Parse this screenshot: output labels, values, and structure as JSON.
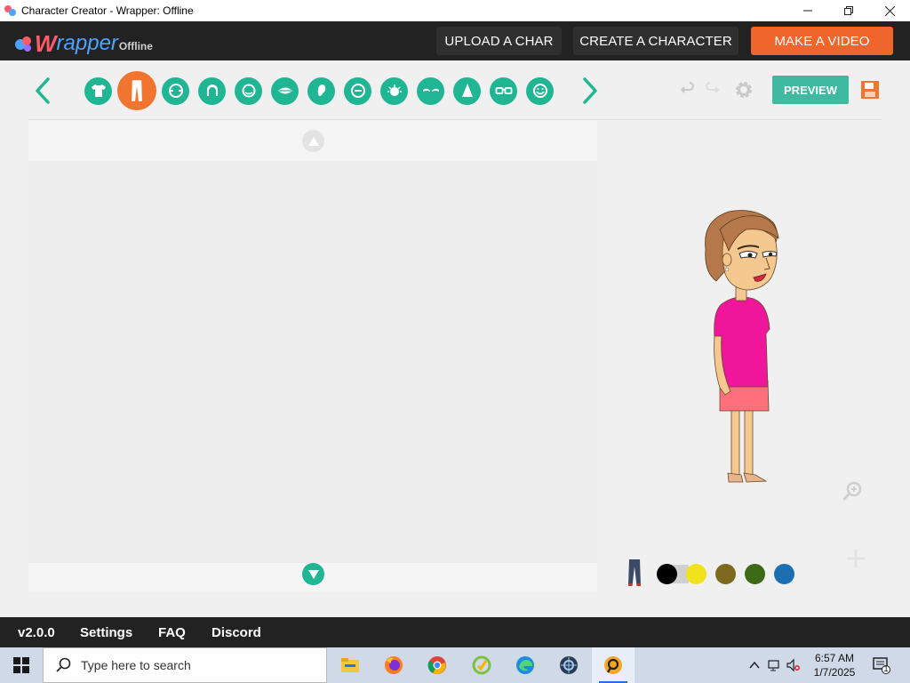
{
  "window": {
    "title": "Character Creator - Wrapper: Offline",
    "app_icon": "wrapper-logo-icon",
    "controls": [
      "minimize-icon",
      "restore-icon",
      "close-icon"
    ]
  },
  "header": {
    "logo_main": "W",
    "logo_rest": "rapper",
    "logo_suffix": "Offline",
    "buttons": {
      "upload": "UPLOAD A CHAR",
      "create": "CREATE A CHARACTER",
      "video": "MAKE A VIDEO"
    },
    "colors": {
      "bar": "#222222",
      "button": "#2f2f2f",
      "accent": "#f0652b"
    }
  },
  "toolbar": {
    "categories": [
      {
        "icon": "shirt-icon",
        "active": false
      },
      {
        "icon": "pants-icon",
        "active": true
      },
      {
        "icon": "face-shape-icon",
        "active": false
      },
      {
        "icon": "hair-icon",
        "active": false
      },
      {
        "icon": "head-icon",
        "active": false
      },
      {
        "icon": "mouth-icon",
        "active": false
      },
      {
        "icon": "ear-icon",
        "active": false
      },
      {
        "icon": "facial-feature-icon",
        "active": false
      },
      {
        "icon": "eye-icon",
        "active": false
      },
      {
        "icon": "eyebrow-icon",
        "active": false
      },
      {
        "icon": "nose-icon",
        "active": false
      },
      {
        "icon": "glasses-icon",
        "active": false
      },
      {
        "icon": "beard-icon",
        "active": false
      }
    ],
    "preview_label": "PREVIEW",
    "colors": {
      "category": "#20b593",
      "active": "#f2752f",
      "preview": "#3fb9a0"
    }
  },
  "swatches": {
    "item_icon": "pants-icon",
    "colors": [
      "#000000",
      "#f0e21c",
      "#7d6a1e",
      "#3d6a17",
      "#1c6fb0"
    ],
    "selected_index": 0
  },
  "footer": {
    "version": "v2.0.0",
    "settings": "Settings",
    "faq": "FAQ",
    "discord": "Discord"
  },
  "taskbar": {
    "search_placeholder": "Type here to search",
    "apps": [
      "file-explorer-icon",
      "firefox-icon",
      "chrome-icon",
      "app-icon",
      "edge-icon",
      "app-icon",
      "wrapper-app-icon"
    ],
    "time": "6:57 AM",
    "date": "1/7/2025",
    "notification_count": "1"
  }
}
